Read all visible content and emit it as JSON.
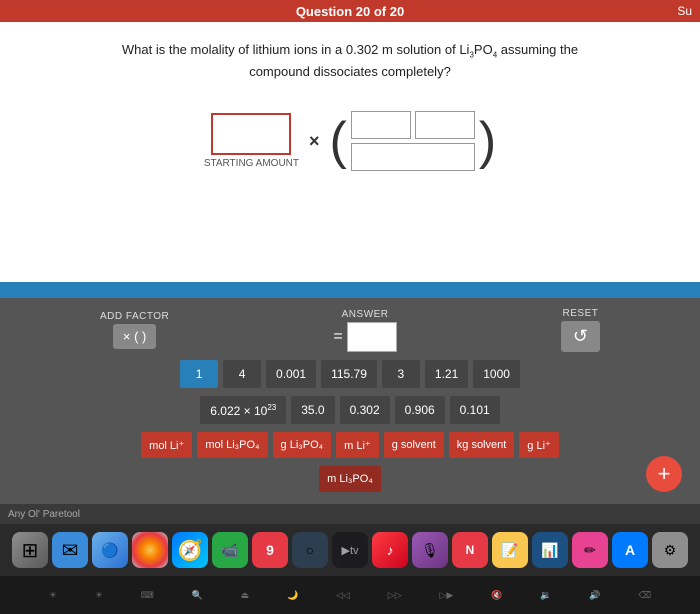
{
  "topBar": {
    "title": "Question 20 of 20",
    "suLabel": "Su"
  },
  "question": {
    "text": "What is the molality of lithium ions in a 0.302 m solution of Li₃PO₄ assuming the compound dissociates completely?"
  },
  "equationArea": {
    "startingLabel": "STARTING AMOUNT",
    "timesSymbol": "×"
  },
  "calculator": {
    "addFactorLabel": "ADD FACTOR",
    "addFactorBtn": "× (  )",
    "answerLabel": "ANSWER",
    "eqSign": "=",
    "resetLabel": "RESET",
    "resetIcon": "↺",
    "numbers": [
      "1",
      "4",
      "0.001",
      "115.79",
      "3",
      "1.21",
      "1000"
    ],
    "numbers2": [
      "6.022 × 10²³",
      "35.0",
      "0.302",
      "0.906",
      "0.101"
    ],
    "units": [
      "mol Li⁺",
      "mol Li₃PO₄",
      "g Li₃PO₄",
      "m Li⁺",
      "g solvent",
      "kg solvent",
      "g Li⁺"
    ],
    "units2": [
      "m Li₃PO₄"
    ],
    "plusBtn": "+"
  },
  "taskbar": {
    "label": "Any Ol' Paretool"
  },
  "dock": {
    "icons": [
      {
        "name": "launchpad",
        "symbol": "⊞"
      },
      {
        "name": "finder",
        "symbol": "🔵"
      },
      {
        "name": "mail",
        "symbol": "✉"
      },
      {
        "name": "photos",
        "symbol": "🌸"
      },
      {
        "name": "safari",
        "symbol": "🧭"
      },
      {
        "name": "facetime",
        "symbol": "📹"
      },
      {
        "name": "calendar",
        "symbol": "📅"
      },
      {
        "name": "generic9",
        "symbol": "9"
      },
      {
        "name": "generic-circle",
        "symbol": "○"
      },
      {
        "name": "atv",
        "symbol": "▶"
      },
      {
        "name": "music",
        "symbol": "♪"
      },
      {
        "name": "podcast",
        "symbol": "🎙"
      },
      {
        "name": "news",
        "symbol": "N"
      },
      {
        "name": "notes",
        "symbol": "📝"
      },
      {
        "name": "bars",
        "symbol": "📊"
      },
      {
        "name": "pen",
        "symbol": "✏"
      },
      {
        "name": "appstore",
        "symbol": "A"
      },
      {
        "name": "settings",
        "symbol": "⚙"
      }
    ]
  },
  "keyboard": {
    "keys": [
      "☀",
      "☀",
      "⌨",
      "🔍",
      "⏏",
      "🌙",
      "◁▷",
      "▷▷",
      "▷▶",
      "⌫"
    ]
  }
}
